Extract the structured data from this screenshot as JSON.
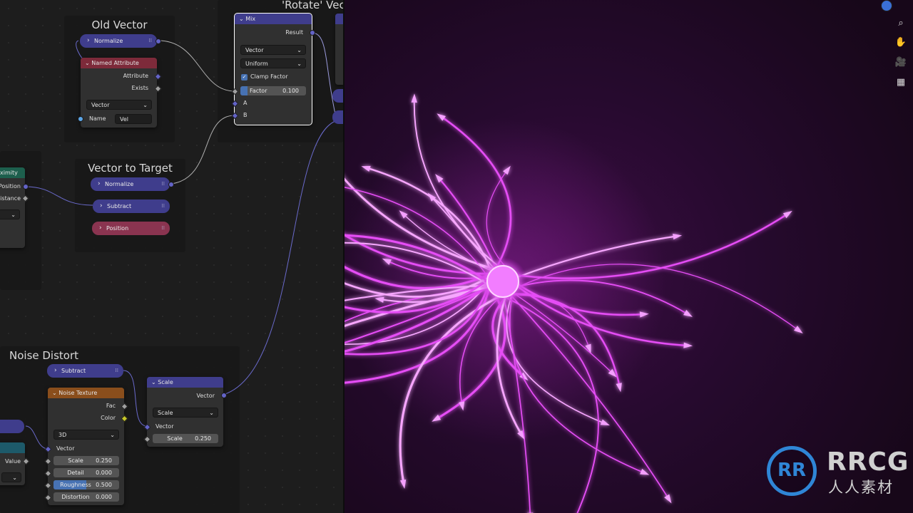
{
  "frames": {
    "old_vector": "Old Vector",
    "rotate_vector": "'Rotate' Vec",
    "vector_to_target": "Vector to Target",
    "noise_distort": "Noise Distort"
  },
  "nodes": {
    "normalize_1": "Normalize",
    "named_attribute": {
      "title": "Named Attribute",
      "attribute": "Attribute",
      "exists": "Exists",
      "type": "Vector",
      "name_label": "Name",
      "name_value": "Vel"
    },
    "mix": {
      "title": "Mix",
      "result": "Result",
      "mode": "Vector",
      "factor_mode": "Uniform",
      "clamp": "Clamp Factor",
      "factor_label": "Factor",
      "factor_value": "0.100",
      "a": "A",
      "b": "B"
    },
    "proximity": {
      "title": "ximity",
      "position": "Position",
      "distance": "istance"
    },
    "normalize_2": "Normalize",
    "subtract_1": "Subtract",
    "position": "Position",
    "subtract_2": "Subtract",
    "noise_texture": {
      "title": "Noise Texture",
      "fac": "Fac",
      "color": "Color",
      "dims": "3D",
      "vector": "Vector",
      "fields": [
        {
          "label": "Scale",
          "value": "0.250"
        },
        {
          "label": "Detail",
          "value": "0.000"
        },
        {
          "label": "Roughness",
          "value": "0.500"
        },
        {
          "label": "Distortion",
          "value": "0.000"
        }
      ]
    },
    "scale": {
      "title": "Scale",
      "output": "Vector",
      "mode": "Scale",
      "vector": "Vector",
      "scale_label": "Scale",
      "scale_value": "0.250"
    },
    "value_node": {
      "value": "Value"
    }
  },
  "viewport": {
    "tools": [
      "zoom-icon",
      "hand-icon",
      "camera-icon",
      "grid-icon"
    ]
  },
  "watermark": {
    "brand": "RRCG",
    "sub": "人人素材",
    "mark": "RR"
  },
  "colors": {
    "vector_node": "#3f3d8c",
    "texture_node": "#8a4e1c",
    "attribute_node": "#7d2a3a",
    "glow": "#e040f0"
  },
  "roughness_fraction": 0.5
}
